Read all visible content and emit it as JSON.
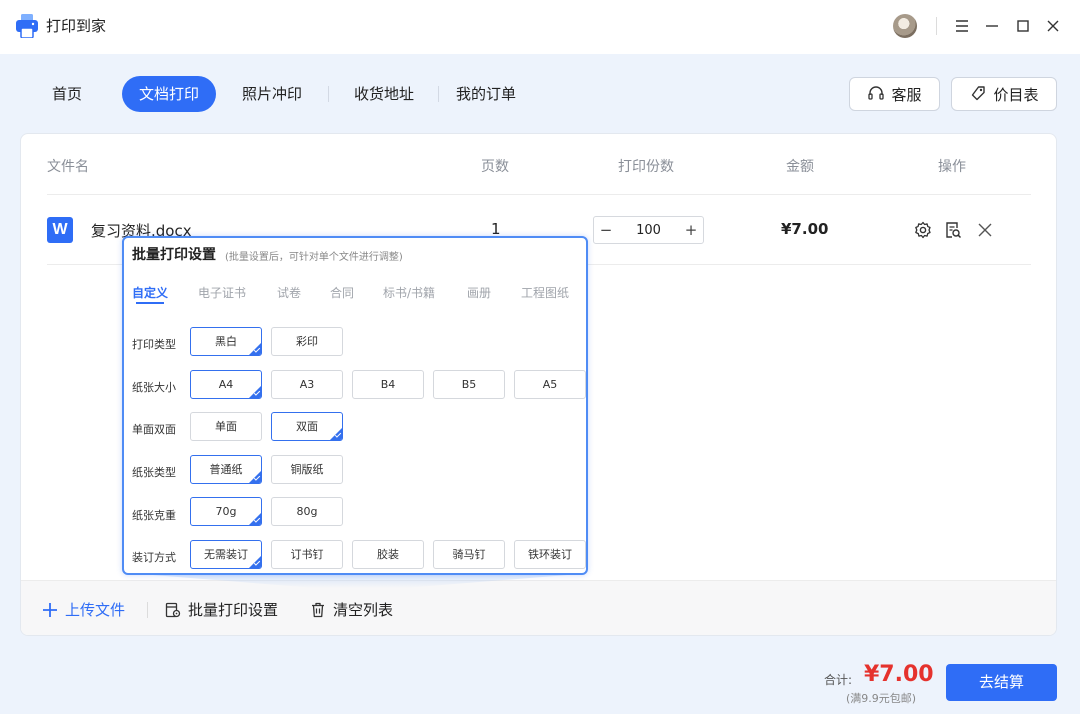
{
  "app": {
    "title": "打印到家"
  },
  "nav": {
    "items": [
      {
        "label": "首页"
      },
      {
        "label": "文档打印"
      },
      {
        "label": "照片冲印"
      },
      {
        "label": "收货地址"
      },
      {
        "label": "我的订单"
      }
    ],
    "active_index": 1,
    "service_label": "客服",
    "price_list_label": "价目表"
  },
  "table": {
    "headers": {
      "filename": "文件名",
      "pages": "页数",
      "copies": "打印份数",
      "amount": "金额",
      "actions": "操作"
    },
    "rows": [
      {
        "filename": "复习资料.docx",
        "pages": "1",
        "copies": "100",
        "amount": "¥7.00"
      }
    ],
    "stepper": {
      "minus": "−",
      "plus": "+"
    }
  },
  "popup": {
    "title": "批量打印设置",
    "subtitle": "(批量设置后，可针对单个文件进行调整)",
    "tabs": [
      "自定义",
      "电子证书",
      "试卷",
      "合同",
      "标书/书籍",
      "画册",
      "工程图纸"
    ],
    "active_tab": 0,
    "settings": [
      {
        "label": "打印类型",
        "options": [
          "黑白",
          "彩印"
        ],
        "selected": 0
      },
      {
        "label": "纸张大小",
        "options": [
          "A4",
          "A3",
          "B4",
          "B5",
          "A5"
        ],
        "selected": 0
      },
      {
        "label": "单面双面",
        "options": [
          "单面",
          "双面"
        ],
        "selected": 1
      },
      {
        "label": "纸张类型",
        "options": [
          "普通纸",
          "铜版纸"
        ],
        "selected": 0
      },
      {
        "label": "纸张克重",
        "options": [
          "70g",
          "80g"
        ],
        "selected": 0
      },
      {
        "label": "装订方式",
        "options": [
          "无需装订",
          "订书钉",
          "胶装",
          "骑马钉",
          "铁环装订"
        ],
        "selected": 0
      }
    ]
  },
  "bottom_bar": {
    "upload_label": "上传文件",
    "batch_label": "批量打印设置",
    "clear_label": "清空列表"
  },
  "footer": {
    "total_label": "合计:",
    "total_value": "¥7.00",
    "note": "(满9.9元包邮)",
    "checkout_label": "去结算"
  },
  "colors": {
    "accent": "#2f6df6",
    "price": "#e5322d",
    "background": "#edf3fc"
  }
}
